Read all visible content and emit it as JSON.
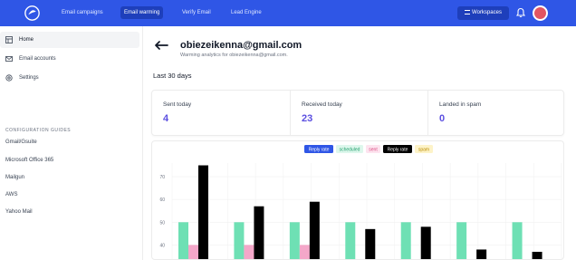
{
  "nav": {
    "items": [
      "Email campaigns",
      "Email warming",
      "Verify Email",
      "Lead Engine"
    ],
    "active_index": 1,
    "workspaces_label": "Workspaces"
  },
  "sidebar": {
    "items": [
      {
        "label": "Home",
        "icon": "home-icon",
        "active": true
      },
      {
        "label": "Email accounts",
        "icon": "envelope-icon",
        "active": false
      },
      {
        "label": "Settings",
        "icon": "gear-icon",
        "active": false
      }
    ],
    "guides_title": "CONFIGURATION GUIDES",
    "guides": [
      "Gmail/Gsuite",
      "Microsoft Office 365",
      "Mailgun",
      "AWS",
      "Yahoo Mail"
    ]
  },
  "page": {
    "email": "obiezeikenna@gmail.com",
    "subtitle": "Warming analytics for obiezeikenna@gmail.com.",
    "period": "Last 30 days"
  },
  "stats": [
    {
      "label": "Sent today",
      "value": "4"
    },
    {
      "label": "Received today",
      "value": "23"
    },
    {
      "label": "Landed in spam",
      "value": "0"
    }
  ],
  "colors": {
    "topbar": "#2f56e6",
    "accent_value": "#5b4fe0",
    "scheduled": "#6ee0b4",
    "sent": "#f4a7c9",
    "reply": "#000000",
    "spam": "#f8e28a"
  },
  "chart_data": {
    "type": "bar",
    "legend": [
      {
        "label": "Reply rate",
        "style": "pill-blue"
      },
      {
        "label": "scheduled",
        "style": "scheduled"
      },
      {
        "label": "sent",
        "style": "sent"
      },
      {
        "label": "Reply rate",
        "style": "pill-black"
      },
      {
        "label": "spam",
        "style": "spam"
      }
    ],
    "y_ticks": [
      40,
      50,
      60,
      70
    ],
    "ylim": [
      33,
      76
    ],
    "groups": 7,
    "series": [
      {
        "name": "scheduled",
        "values": [
          50,
          50,
          50,
          50,
          50,
          50,
          50
        ]
      },
      {
        "name": "sent",
        "values": [
          40,
          40,
          40,
          null,
          null,
          null,
          null
        ]
      },
      {
        "name": "Reply rate",
        "values": [
          75,
          57,
          59,
          47,
          48,
          38,
          37
        ]
      }
    ]
  }
}
